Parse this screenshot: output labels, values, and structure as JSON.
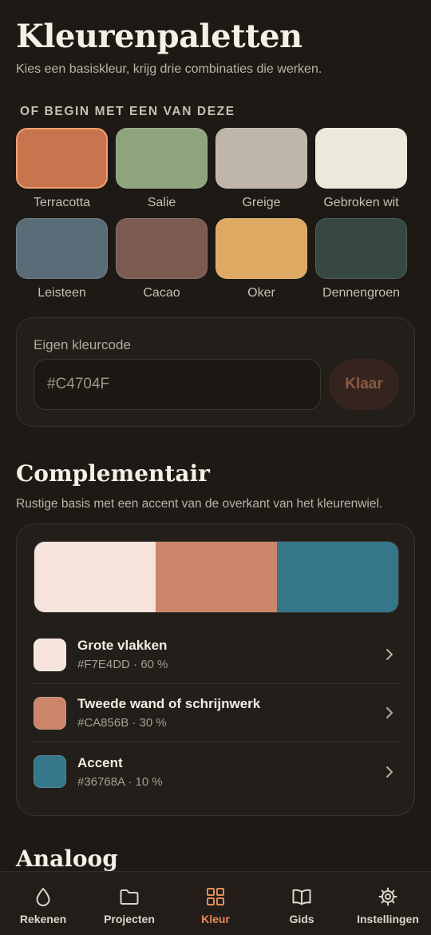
{
  "header": {
    "title": "Kleurenpaletten",
    "subtitle": "Kies een basiskleur, krijg drie combinaties die werken."
  },
  "presets": {
    "label": "OF BEGIN MET EEN VAN DEZE",
    "items": [
      {
        "name": "Terracotta",
        "color": "#c8744f",
        "selected": true
      },
      {
        "name": "Salie",
        "color": "#8ea47f"
      },
      {
        "name": "Greige",
        "color": "#bfb5a9"
      },
      {
        "name": "Gebroken wit",
        "color": "#ede8dc"
      },
      {
        "name": "Leisteen",
        "color": "#5b6c79"
      },
      {
        "name": "Cacao",
        "color": "#7a5a51"
      },
      {
        "name": "Oker",
        "color": "#dea962"
      },
      {
        "name": "Dennengroen",
        "color": "#364841"
      }
    ]
  },
  "custom_code": {
    "label": "Eigen kleurcode",
    "placeholder": "#C4704F",
    "button": "Klaar"
  },
  "complementary": {
    "title": "Complementair",
    "description": "Rustige basis met een accent van de overkant van het kleurenwiel.",
    "bar": [
      "#f7e4dd",
      "#ca856b",
      "#36768a"
    ],
    "rows": [
      {
        "title": "Grote vlakken",
        "meta": "#F7E4DD · 60 %",
        "color": "#f7e4dd"
      },
      {
        "title": "Tweede wand of schrijnwerk",
        "meta": "#CA856B · 30 %",
        "color": "#ca856b"
      },
      {
        "title": "Accent",
        "meta": "#36768A · 10 %",
        "color": "#36768a"
      }
    ]
  },
  "analogous": {
    "title": "Analoog"
  },
  "nav": {
    "items": [
      {
        "label": "Rekenen",
        "icon": "drop-icon"
      },
      {
        "label": "Projecten",
        "icon": "folder-icon"
      },
      {
        "label": "Kleur",
        "icon": "grid-icon",
        "active": true
      },
      {
        "label": "Gids",
        "icon": "book-icon"
      },
      {
        "label": "Instellingen",
        "icon": "gear-icon"
      }
    ],
    "active_color": "#e58a59"
  }
}
